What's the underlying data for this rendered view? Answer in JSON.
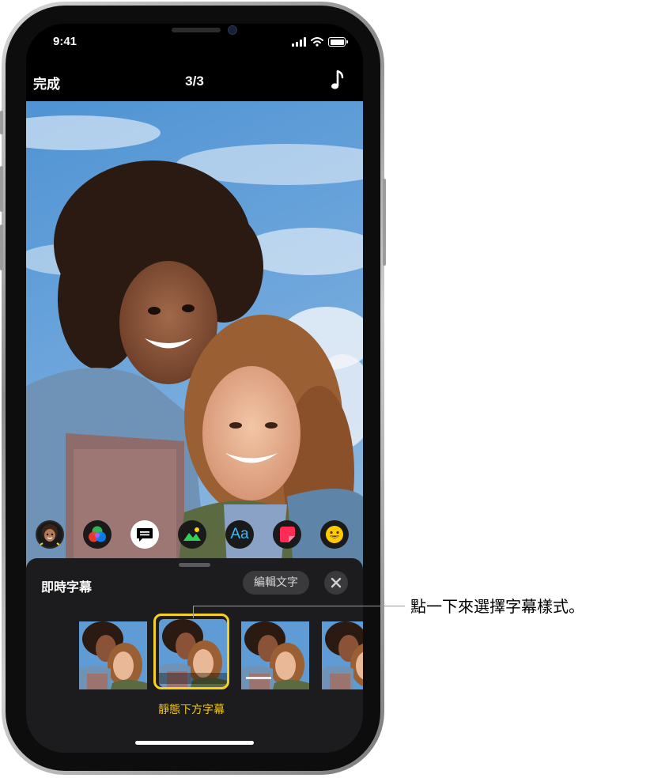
{
  "status_bar": {
    "time": "9:41"
  },
  "navbar": {
    "done_label": "完成",
    "counter": "3/3",
    "music_icon": "music-note-icon"
  },
  "toolbar": {
    "tools": [
      "memoji-icon",
      "filters-icon",
      "live-titles-icon",
      "posters-icon",
      "text-icon",
      "stickers-icon",
      "emoji-icon"
    ],
    "text_tool_label": "Aa",
    "selected": "live-titles-icon"
  },
  "sheet": {
    "title": "即時字幕",
    "edit_text_label": "編輯文字",
    "close_icon": "close-icon",
    "selected_style_name": "靜態下方字幕"
  },
  "callout": {
    "text": "點一下來選擇字幕樣式。"
  },
  "colors": {
    "accent_yellow": "#F7D11C",
    "sheet_bg": "#1C1C1E",
    "aa_blue": "#3FB8F6"
  }
}
